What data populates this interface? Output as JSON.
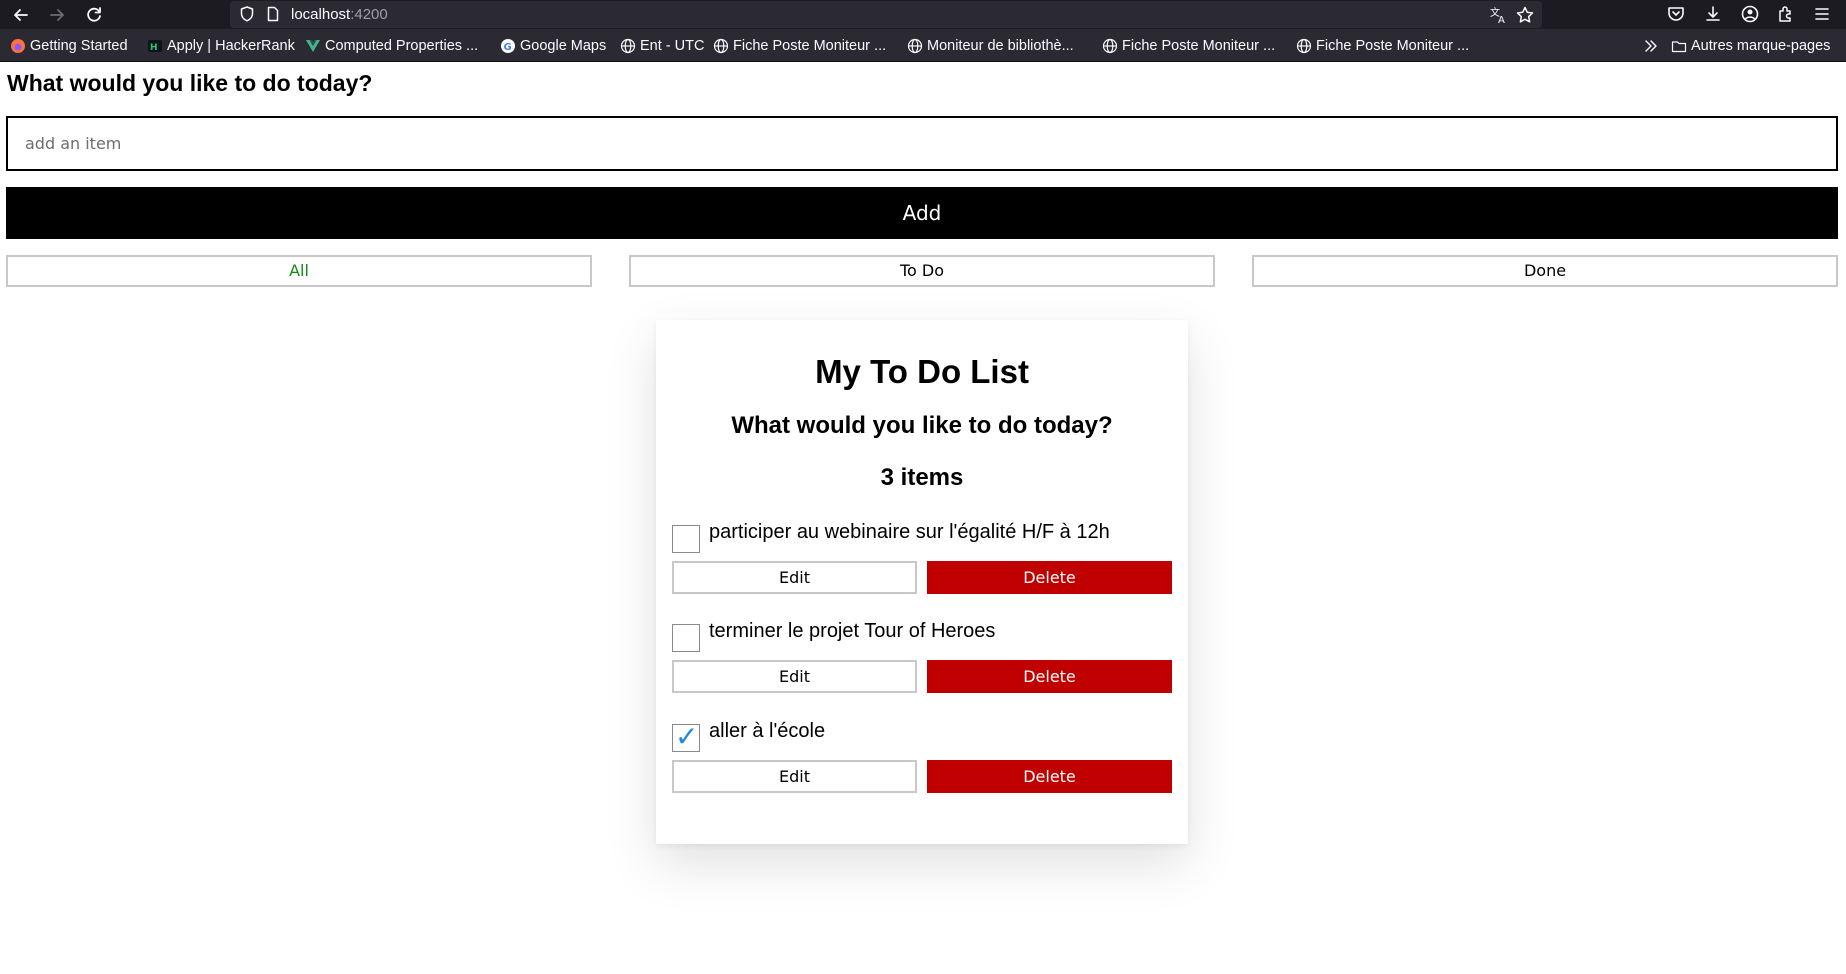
{
  "browser": {
    "url_host": "localhost",
    "url_port": ":4200",
    "bookmarks": [
      {
        "label": "Getting Started",
        "icon": "firefox-icon"
      },
      {
        "label": "Apply | HackerRank",
        "icon": "hackerrank-icon"
      },
      {
        "label": "Computed Properties ...",
        "icon": "vue-icon"
      },
      {
        "label": "Google Maps",
        "icon": "google-icon"
      },
      {
        "label": "Ent - UTC",
        "icon": "globe-icon"
      },
      {
        "label": "Fiche Poste Moniteur ...",
        "icon": "globe-icon"
      },
      {
        "label": "Moniteur de bibliothè...",
        "icon": "globe-icon"
      },
      {
        "label": "Fiche Poste Moniteur ...",
        "icon": "globe-icon"
      },
      {
        "label": "Fiche Poste Moniteur ...",
        "icon": "globe-icon"
      }
    ],
    "other_bookmarks": "Autres marque-pages"
  },
  "page": {
    "heading": "What would you like to do today?",
    "input_placeholder": "add an item",
    "add_label": "Add",
    "filters": [
      {
        "label": "All",
        "active": true
      },
      {
        "label": "To Do",
        "active": false
      },
      {
        "label": "Done",
        "active": false
      }
    ]
  },
  "card": {
    "title": "My To Do List",
    "subtitle": "What would you like to do today?",
    "count": "3 items",
    "items": [
      {
        "label": "participer au webinaire sur l'égalité H/F à 12h",
        "done": false,
        "edit": "Edit",
        "delete": "Delete"
      },
      {
        "label": "terminer le projet Tour of Heroes",
        "done": false,
        "edit": "Edit",
        "delete": "Delete"
      },
      {
        "label": "aller à l'école",
        "done": true,
        "edit": "Edit",
        "delete": "Delete"
      }
    ]
  },
  "colors": {
    "chrome_bg": "#1c1b22",
    "bookmarks_bg": "#2b2a33",
    "active_filter": "#118c11",
    "delete_bg": "#c00000",
    "check_blue": "#1e88e5"
  }
}
